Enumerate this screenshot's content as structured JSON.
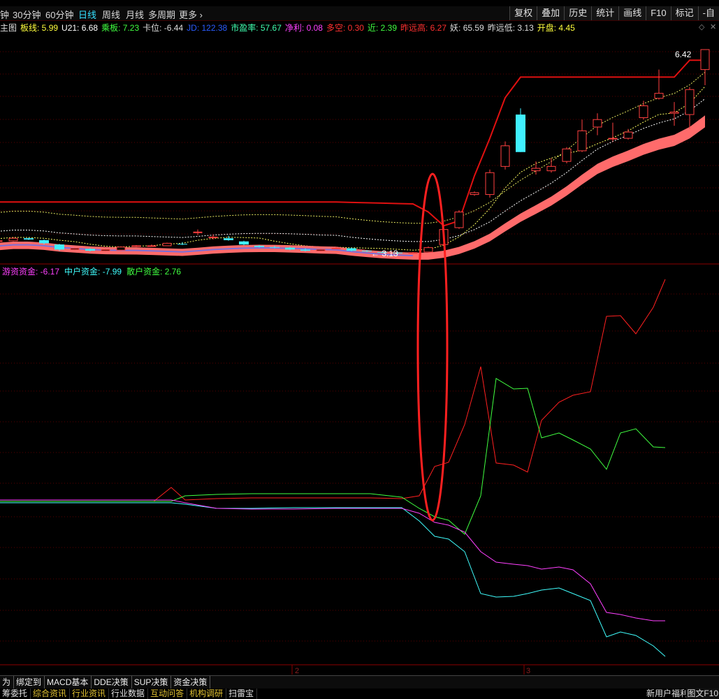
{
  "period_tabs": [
    {
      "label": "钟",
      "x": 0,
      "active": false
    },
    {
      "label": "30分钟",
      "x": 18,
      "active": false
    },
    {
      "label": "60分钟",
      "x": 65,
      "active": false
    },
    {
      "label": "日线",
      "x": 112,
      "active": true
    },
    {
      "label": "周线",
      "x": 146,
      "active": false
    },
    {
      "label": "月线",
      "x": 180,
      "active": false
    },
    {
      "label": "多周期",
      "x": 212,
      "active": false
    },
    {
      "label": "更多",
      "x": 256,
      "active": false
    }
  ],
  "more_arrow": "›",
  "right_tools": [
    "复权",
    "叠加",
    "历史",
    "统计",
    "画线",
    "F10",
    "标记",
    "-自"
  ],
  "main_indicators": [
    {
      "label": "主图",
      "color": "#dddddd"
    },
    {
      "label": "板线: 5.99",
      "color": "#ffff3c"
    },
    {
      "label": "U21: 6.68",
      "color": "#ffffff"
    },
    {
      "label": "乘板: 7.23",
      "color": "#40ff40"
    },
    {
      "label": "卡位: -6.44",
      "color": "#dddddd"
    },
    {
      "label": "JD: 122.38",
      "color": "#2a5cff"
    },
    {
      "label": "市盈率: 57.67",
      "color": "#40ffb0"
    },
    {
      "label": "净利: 0.08",
      "color": "#ff40ff"
    },
    {
      "label": "多空: 0.30",
      "color": "#ff3030"
    },
    {
      "label": "近: 2.39",
      "color": "#40ff40"
    },
    {
      "label": "昨远高: 6.27",
      "color": "#ff3030"
    },
    {
      "label": "妖: 65.59",
      "color": "#dddddd"
    },
    {
      "label": "昨远低: 3.13",
      "color": "#dddddd"
    },
    {
      "label": "开盘: 4.45",
      "color": "#ffff3c"
    }
  ],
  "fund_indicators": [
    {
      "label": "游资资金: -6.17",
      "color": "#ff40ff"
    },
    {
      "label": "中户资金: -7.99",
      "color": "#40ffff"
    },
    {
      "label": "散户资金: 2.76",
      "color": "#40ff40"
    }
  ],
  "price_labels": {
    "high": "6.42",
    "low": "← 3.13"
  },
  "x_axis_labels": [
    "2",
    "3"
  ],
  "bottom_tabs": [
    "为",
    "绑定到",
    "MACD基本",
    "DDE决策",
    "SUP决策",
    "资金决策"
  ],
  "bottom_links": [
    {
      "label": "筹委托",
      "color": "#e0e0e0"
    },
    {
      "label": "综合资讯",
      "color": "#e0c030"
    },
    {
      "label": "行业资讯",
      "color": "#e0c030"
    },
    {
      "label": "行业数据",
      "color": "#e0e0e0"
    },
    {
      "label": "互动问答",
      "color": "#e0c030"
    },
    {
      "label": "机构调研",
      "color": "#e0c030"
    },
    {
      "label": "扫雷宝",
      "color": "#e0e0e0"
    }
  ],
  "promo_text": "新用户福利专享",
  "promo_text2": "图文F10",
  "colors": {
    "up": "#ff4040",
    "down": "#40f0ff",
    "band": "#ff6b6b",
    "resistance": "#e01010",
    "annotation": "#ff2020",
    "youzi": "#ff40ff",
    "zhonghu": "#40ffff",
    "sanhu": "#40ff40",
    "zhuli": "#ff2020"
  },
  "chart_data": [
    {
      "type": "candlestick",
      "price_range": [
        3.0,
        6.8
      ],
      "candles": [
        [
          3.35,
          3.36,
          3.38,
          3.33
        ],
        [
          3.36,
          3.4,
          3.42,
          3.35
        ],
        [
          3.4,
          3.38,
          3.41,
          3.37
        ],
        [
          3.37,
          3.32,
          3.38,
          3.3
        ],
        [
          3.3,
          3.22,
          3.31,
          3.2
        ],
        [
          3.22,
          3.24,
          3.25,
          3.21
        ],
        [
          3.23,
          3.2,
          3.24,
          3.19
        ],
        [
          3.2,
          3.22,
          3.23,
          3.19
        ],
        [
          3.21,
          3.26,
          3.27,
          3.2
        ],
        [
          3.27,
          3.28,
          3.29,
          3.26
        ],
        [
          3.28,
          3.28,
          3.3,
          3.27
        ],
        [
          3.28,
          3.32,
          3.33,
          3.28
        ],
        [
          3.31,
          3.3,
          3.34,
          3.29
        ],
        [
          3.5,
          3.5,
          3.54,
          3.45
        ],
        [
          3.42,
          3.42,
          3.46,
          3.38
        ],
        [
          3.4,
          3.37,
          3.44,
          3.36
        ],
        [
          3.35,
          3.3,
          3.36,
          3.29
        ],
        [
          3.28,
          3.26,
          3.29,
          3.25
        ],
        [
          3.26,
          3.25,
          3.28,
          3.24
        ],
        [
          3.25,
          3.22,
          3.26,
          3.21
        ],
        [
          3.22,
          3.2,
          3.24,
          3.19
        ],
        [
          3.2,
          3.22,
          3.23,
          3.19
        ],
        [
          3.24,
          3.24,
          3.26,
          3.23
        ],
        [
          3.24,
          3.2,
          3.25,
          3.19
        ],
        [
          3.2,
          3.19,
          3.21,
          3.18
        ],
        [
          3.18,
          3.17,
          3.19,
          3.16
        ],
        [
          3.17,
          3.16,
          3.18,
          3.15
        ],
        [
          3.16,
          3.17,
          3.18,
          3.15
        ],
        [
          3.18,
          3.25,
          3.27,
          3.17
        ],
        [
          3.3,
          3.54,
          3.57,
          3.29
        ],
        [
          3.57,
          3.82,
          3.85,
          3.55
        ],
        [
          4.1,
          4.13,
          4.15,
          4.08
        ],
        [
          4.1,
          4.45,
          4.5,
          4.05
        ],
        [
          4.55,
          4.88,
          4.95,
          4.5
        ],
        [
          5.38,
          4.78,
          5.48,
          4.78
        ],
        [
          4.48,
          4.52,
          4.63,
          4.42
        ],
        [
          4.48,
          4.55,
          4.68,
          4.45
        ],
        [
          4.63,
          4.83,
          4.86,
          4.6
        ],
        [
          4.8,
          5.12,
          5.3,
          4.78
        ],
        [
          5.18,
          5.3,
          5.4,
          5.05
        ],
        [
          5.0,
          5.0,
          5.25,
          4.95
        ],
        [
          5.0,
          5.1,
          5.15,
          4.98
        ],
        [
          5.33,
          5.52,
          5.6,
          5.3
        ],
        [
          5.64,
          5.72,
          6.1,
          5.62
        ],
        [
          5.4,
          5.42,
          5.58,
          5.2
        ],
        [
          5.38,
          5.78,
          5.82,
          5.15
        ],
        [
          6.1,
          6.42,
          6.42,
          5.85
        ]
      ]
    },
    {
      "type": "line",
      "title": "资金决策",
      "series": [
        {
          "name": "游资资金",
          "value_at_end": -6.17
        },
        {
          "name": "中户资金",
          "value_at_end": -7.99
        },
        {
          "name": "散户资金",
          "value_at_end": 2.76
        }
      ]
    }
  ]
}
